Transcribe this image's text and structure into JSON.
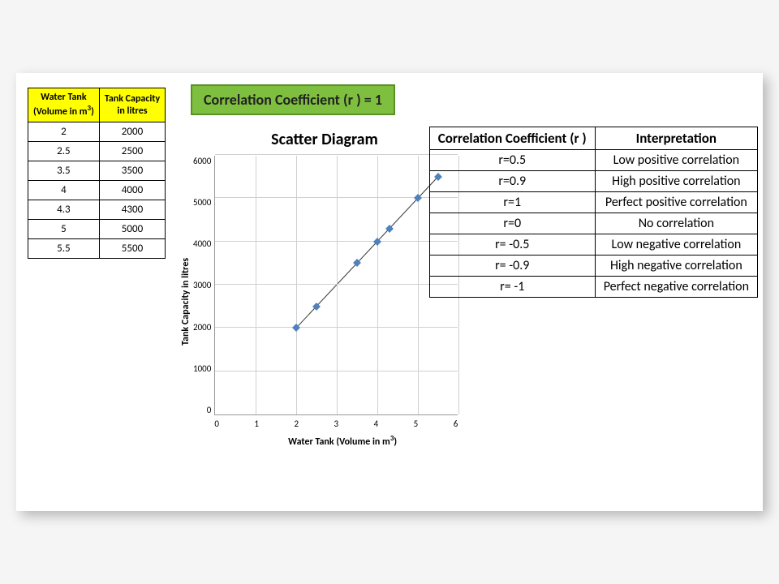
{
  "data_table": {
    "headers": [
      "Water Tank (Volume in m³)",
      "Tank Capacity in litres"
    ],
    "rows": [
      [
        "2",
        "2000"
      ],
      [
        "2.5",
        "2500"
      ],
      [
        "3.5",
        "3500"
      ],
      [
        "4",
        "4000"
      ],
      [
        "4.3",
        "4300"
      ],
      [
        "5",
        "5000"
      ],
      [
        "5.5",
        "5500"
      ]
    ]
  },
  "correlation_box": "Correlation Coefficient (r ) = 1",
  "chart_data": {
    "type": "scatter",
    "title": "Scatter Diagram",
    "xlabel": "Water Tank (Volume in m³)",
    "ylabel": "Tank Capacity in litres",
    "x": [
      2,
      2.5,
      3.5,
      4,
      4.3,
      5,
      5.5
    ],
    "y": [
      2000,
      2500,
      3500,
      4000,
      4300,
      5000,
      5500
    ],
    "xlim": [
      0,
      6
    ],
    "ylim": [
      0,
      6000
    ],
    "xticks": [
      0,
      1,
      2,
      3,
      4,
      5,
      6
    ],
    "yticks": [
      0,
      1000,
      2000,
      3000,
      4000,
      5000,
      6000
    ],
    "grid": true,
    "trendline": true
  },
  "interp_table": {
    "headers": [
      "Correlation Coefficient (r )",
      "Interpretation"
    ],
    "rows": [
      [
        "r=0.5",
        "Low positive correlation"
      ],
      [
        "r=0.9",
        "High positive correlation"
      ],
      [
        "r=1",
        "Perfect positive correlation"
      ],
      [
        "r=0",
        "No correlation"
      ],
      [
        "r= -0.5",
        "Low negative correlation"
      ],
      [
        "r= -0.9",
        "High negative correlation"
      ],
      [
        "r= -1",
        "Perfect negative correlation"
      ]
    ]
  }
}
